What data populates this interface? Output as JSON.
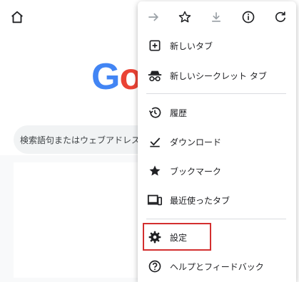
{
  "search": {
    "placeholder": "検索語句またはウェブアドレスを"
  },
  "menu": {
    "toolbar": [
      "forward-icon",
      "star-icon",
      "download-icon",
      "info-icon",
      "reload-icon"
    ],
    "items": [
      {
        "label": "新しいタブ",
        "icon": "new-tab-icon"
      },
      {
        "label": "新しいシークレット タブ",
        "icon": "incognito-icon"
      },
      {
        "label": "履歴",
        "icon": "history-icon"
      },
      {
        "label": "ダウンロード",
        "icon": "downloads-icon"
      },
      {
        "label": "ブックマーク",
        "icon": "bookmark-star-icon"
      },
      {
        "label": "最近使ったタブ",
        "icon": "recent-tabs-icon"
      },
      {
        "label": "設定",
        "icon": "gear-icon"
      },
      {
        "label": "ヘルプとフィードバック",
        "icon": "help-icon"
      }
    ]
  },
  "colors": {
    "accent": "#4285f4",
    "highlight": "#d32f2f"
  }
}
